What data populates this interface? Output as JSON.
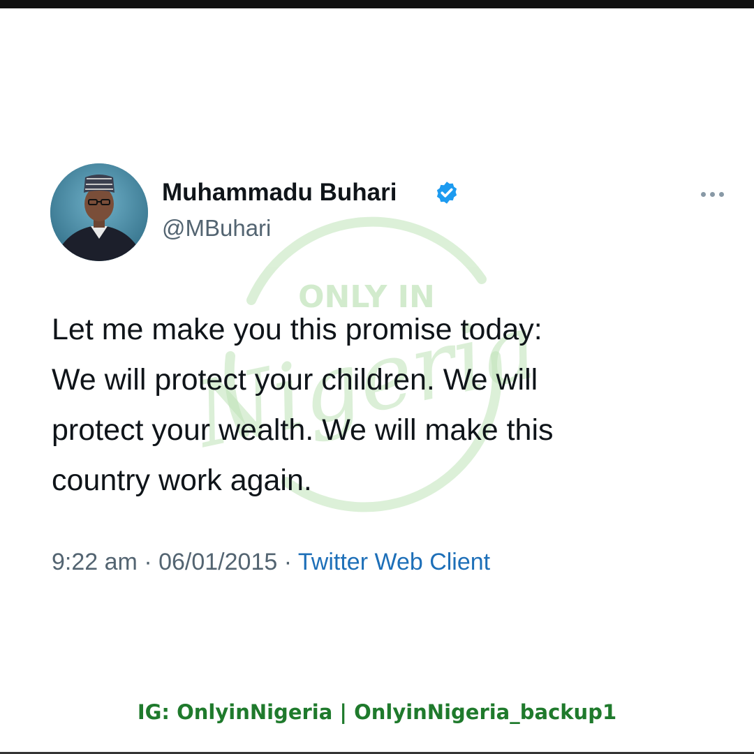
{
  "tweet": {
    "author_name": "Muhammadu Buhari",
    "handle": "@MBuhari",
    "text_lines": [
      "Let me make you this promise today:",
      "We will protect your children. We will",
      "protect your wealth. We will make this",
      "country work again."
    ],
    "time": "9:22 am",
    "separator": "·",
    "date": "06/01/2015",
    "source": "Twitter Web Client",
    "icons": {
      "verified": "verified-badge-icon",
      "more": "more-options-icon"
    }
  },
  "watermark": {
    "top_text": "ONLY IN",
    "script_text": "Nigeria"
  },
  "footer": {
    "text": "IG: OnlyinNigeria  |  OnlyinNigeria_backup1"
  },
  "colors": {
    "verified_blue": "#1d9bf0",
    "link_blue": "#1d6fb8",
    "footer_green": "#1f7a2c",
    "watermark_green": "#bfe3b8"
  }
}
